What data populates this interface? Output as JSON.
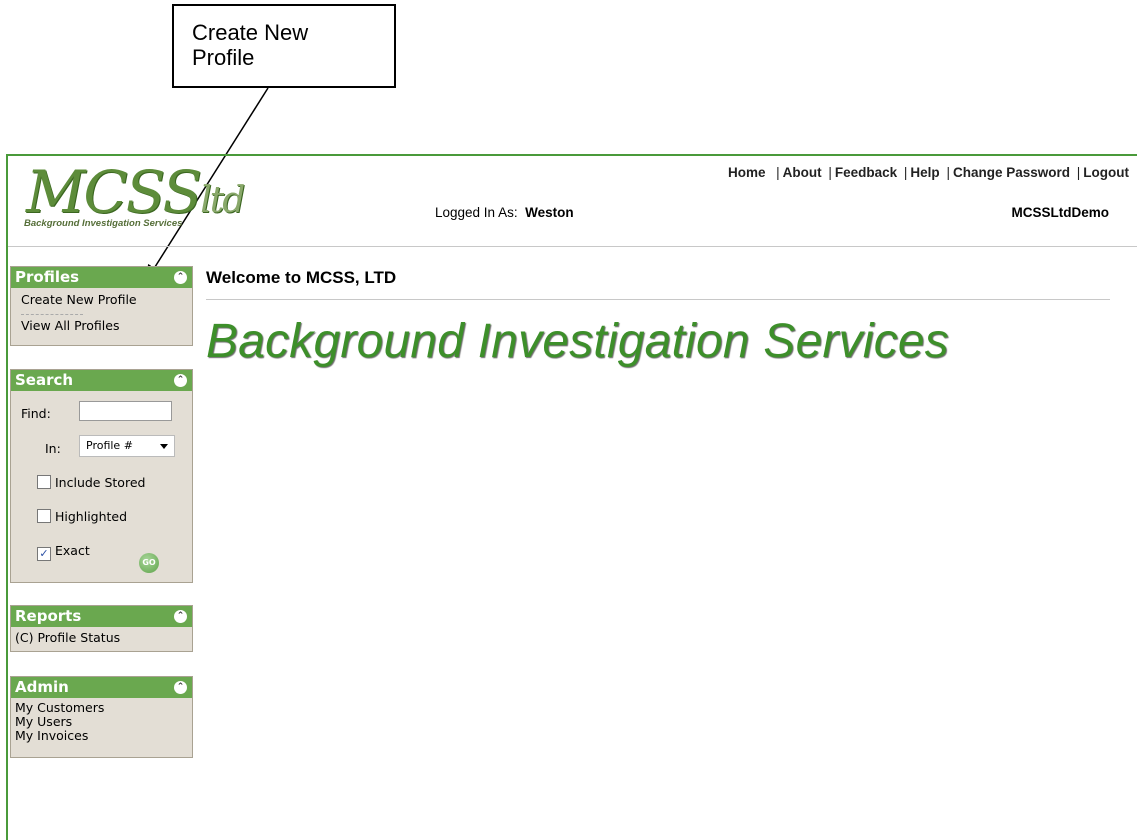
{
  "callout": {
    "text_line1": "Create New",
    "text_line2": "Profile"
  },
  "logo": {
    "mark": "MCSS",
    "mark_suffix": "ltd",
    "tagline": "Background Investigation Services"
  },
  "top_nav": {
    "items": [
      "Home",
      "About",
      "Feedback",
      "Help",
      "Change Password",
      "Logout"
    ]
  },
  "login": {
    "label": "Logged In As:",
    "user": "Weston"
  },
  "client": "MCSSLtdDemo",
  "profiles": {
    "title": "Profiles",
    "items": [
      "Create New Profile",
      "View All Profiles"
    ],
    "divider": "----------"
  },
  "search": {
    "title": "Search",
    "find_label": "Find:",
    "find_value": "",
    "in_label": "In:",
    "in_selected": "Profile #",
    "include_stored": {
      "label": "Include Stored",
      "checked": false
    },
    "highlighted": {
      "label": "Highlighted",
      "checked": false
    },
    "exact": {
      "label": "Exact",
      "checked": true
    },
    "go_label": "GO"
  },
  "reports": {
    "title": "Reports",
    "items": [
      "(C) Profile Status"
    ]
  },
  "admin": {
    "title": "Admin",
    "items": [
      "My Customers",
      "My Users",
      "My Invoices"
    ]
  },
  "main": {
    "welcome": "Welcome to MCSS, LTD",
    "title": "Background Investigation Services"
  },
  "colors": {
    "accent_green": "#6aa84f",
    "title_green": "#3d8f2a",
    "panel_bg": "#e3ded5"
  }
}
